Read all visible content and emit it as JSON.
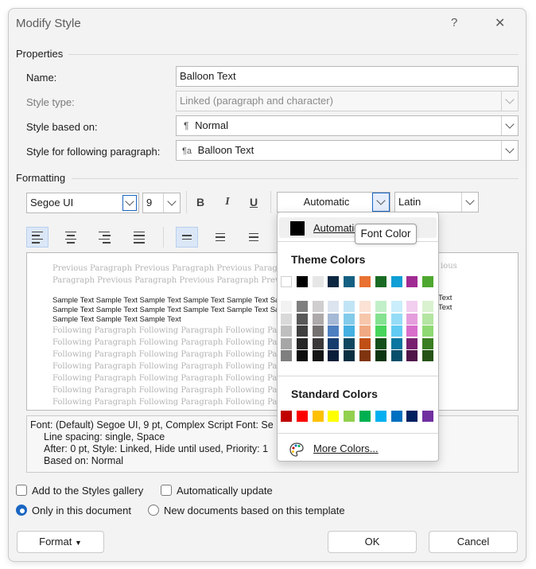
{
  "window": {
    "title": "Modify Style",
    "help_glyph": "?",
    "close_glyph": "✕"
  },
  "properties": {
    "section_label": "Properties",
    "name_label": "Name:",
    "name_value": "Balloon Text",
    "style_type_label": "Style type:",
    "style_type_value": "Linked (paragraph and character)",
    "based_on_label": "Style based on:",
    "based_on_glyph": "¶",
    "based_on_value": "Normal",
    "following_label": "Style for following paragraph:",
    "following_glyph": "¶a",
    "following_value": "Balloon Text"
  },
  "formatting": {
    "section_label": "Formatting",
    "font": "Segoe UI",
    "size": "9",
    "bold": "B",
    "italic": "I",
    "underline": "U",
    "color": "Automatic",
    "script": "Latin"
  },
  "preview": {
    "previous_line_1": "Previous Paragraph Previous Paragraph Previous Paragraph",
    "previous_line_1_tail": "ious",
    "previous_line_2": "Paragraph Previous Paragraph Previous Paragraph Previous P",
    "sample_line_1": "Sample Text Sample Text Sample Text Sample Text Sample Text Sa",
    "sample_line_2": "Sample Text Sample Text Sample Text Sample Text Sample Text Sa",
    "sample_line_3": "Sample Text Sample Text Sample Text",
    "sample_tail": "Text",
    "following_line": "Following Paragraph Following Paragraph Following Paragraph"
  },
  "description": {
    "line_1": "Font: (Default) Segoe UI, 9 pt, Complex Script Font: Se",
    "line_2": "Line spacing:  single, Space",
    "line_3": "After:  0 pt, Style: Linked, Hide until used, Priority: 1",
    "line_4": "Based on: Normal"
  },
  "options": {
    "add_gallery": "Add to the Styles gallery",
    "auto_update": "Automatically update",
    "only_doc": "Only in this document",
    "new_docs": "New documents based on this template",
    "only_doc_selected": true
  },
  "buttons": {
    "format": "Format",
    "ok": "OK",
    "cancel": "Cancel"
  },
  "color_menu": {
    "automatic": "Automatic",
    "theme_label": "Theme Colors",
    "standard_label": "Standard Colors",
    "more_colors": "More Colors...",
    "tooltip": "Font Color",
    "theme_top": [
      "#ffffff",
      "#000000",
      "#e7e6e6",
      "#0e2841",
      "#156082",
      "#e97132",
      "#196b24",
      "#0f9ed5",
      "#a02b93",
      "#4ea72e"
    ],
    "theme_shades": [
      [
        "#f2f2f2",
        "#7f7f7f",
        "#d0cece",
        "#dce4f0",
        "#c1e4f5",
        "#fbe2d5",
        "#c1f0c8",
        "#caeefb",
        "#f2ceef",
        "#daf2d0"
      ],
      [
        "#d9d9d9",
        "#595959",
        "#aeaaaa",
        "#a5b8d5",
        "#83cbeb",
        "#f7c7ac",
        "#84e291",
        "#95dcf7",
        "#e59edd",
        "#b4e5a2"
      ],
      [
        "#bfbfbf",
        "#404040",
        "#757171",
        "#4e7fc0",
        "#45b0e1",
        "#f1a983",
        "#48d55b",
        "#61cbf3",
        "#d86dcb",
        "#8ed973"
      ],
      [
        "#a6a6a6",
        "#262626",
        "#3a3838",
        "#163c6e",
        "#0f4761",
        "#c04f15",
        "#124f1a",
        "#0b76a0",
        "#782170",
        "#3a7d22"
      ],
      [
        "#7f7f7f",
        "#0d0d0d",
        "#171616",
        "#0a1e39",
        "#0a2f41",
        "#80350e",
        "#0c3512",
        "#074f6a",
        "#501549",
        "#275317"
      ]
    ],
    "standard": [
      "#c00000",
      "#ff0000",
      "#ffc000",
      "#ffff00",
      "#92d050",
      "#00b050",
      "#00b0f0",
      "#0070c0",
      "#002060",
      "#7030a0"
    ]
  }
}
